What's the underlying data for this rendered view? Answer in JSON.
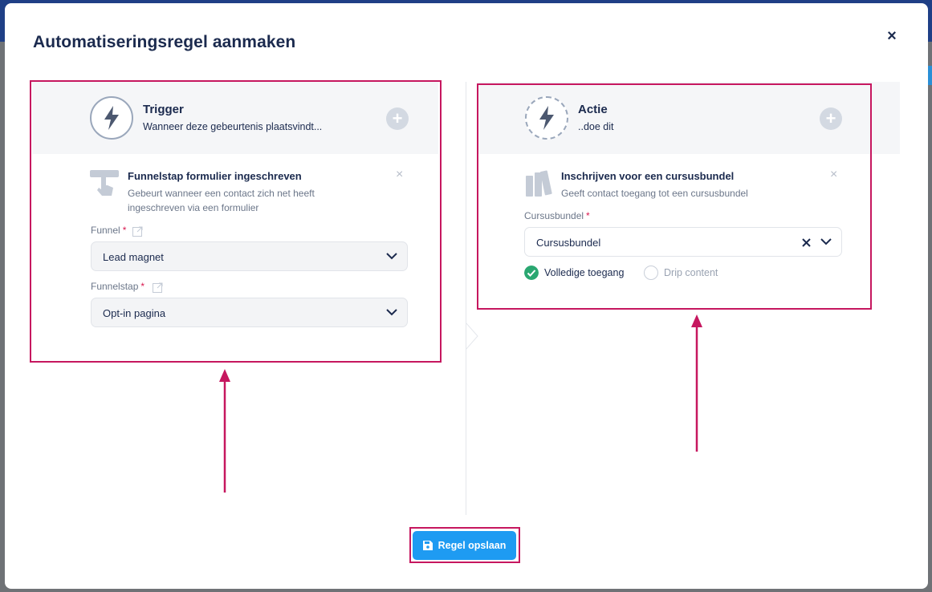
{
  "modal": {
    "title": "Automatiseringsregel aanmaken",
    "close_label": "×"
  },
  "trigger": {
    "title": "Trigger",
    "subtitle": "Wanneer deze gebeurtenis plaatsvindt...",
    "item": {
      "title": "Funnelstap formulier ingeschreven",
      "description_line1": "Gebeurt wanneer een contact zich net heeft",
      "description_line2": "ingeschreven via een formulier"
    },
    "funnel": {
      "label": "Funnel",
      "value": "Lead magnet"
    },
    "funnelstap": {
      "label": "Funnelstap",
      "value": "Opt-in pagina"
    }
  },
  "actie": {
    "title": "Actie",
    "subtitle": "..doe dit",
    "item": {
      "title": "Inschrijven voor een cursusbundel",
      "description": "Geeft contact toegang tot een cursusbundel"
    },
    "cursusbundel": {
      "label": "Cursusbundel",
      "value": "Cursusbundel"
    },
    "access_options": [
      {
        "label": "Volledige toegang",
        "selected": true
      },
      {
        "label": "Drip content",
        "selected": false
      }
    ]
  },
  "footer": {
    "save_label": "Regel opslaan"
  },
  "colors": {
    "accent": "#1e9bf2",
    "highlight": "#c6175f",
    "success": "#2aa771",
    "heading": "#1b2a4e",
    "required": "#d9184f"
  },
  "icons": [
    "lightning-icon",
    "plus-icon",
    "hand-pointer-icon",
    "books-icon",
    "external-link-icon",
    "chevron-down-icon",
    "clear-icon",
    "check-circle-icon",
    "floppy-disk-icon",
    "close-icon"
  ]
}
